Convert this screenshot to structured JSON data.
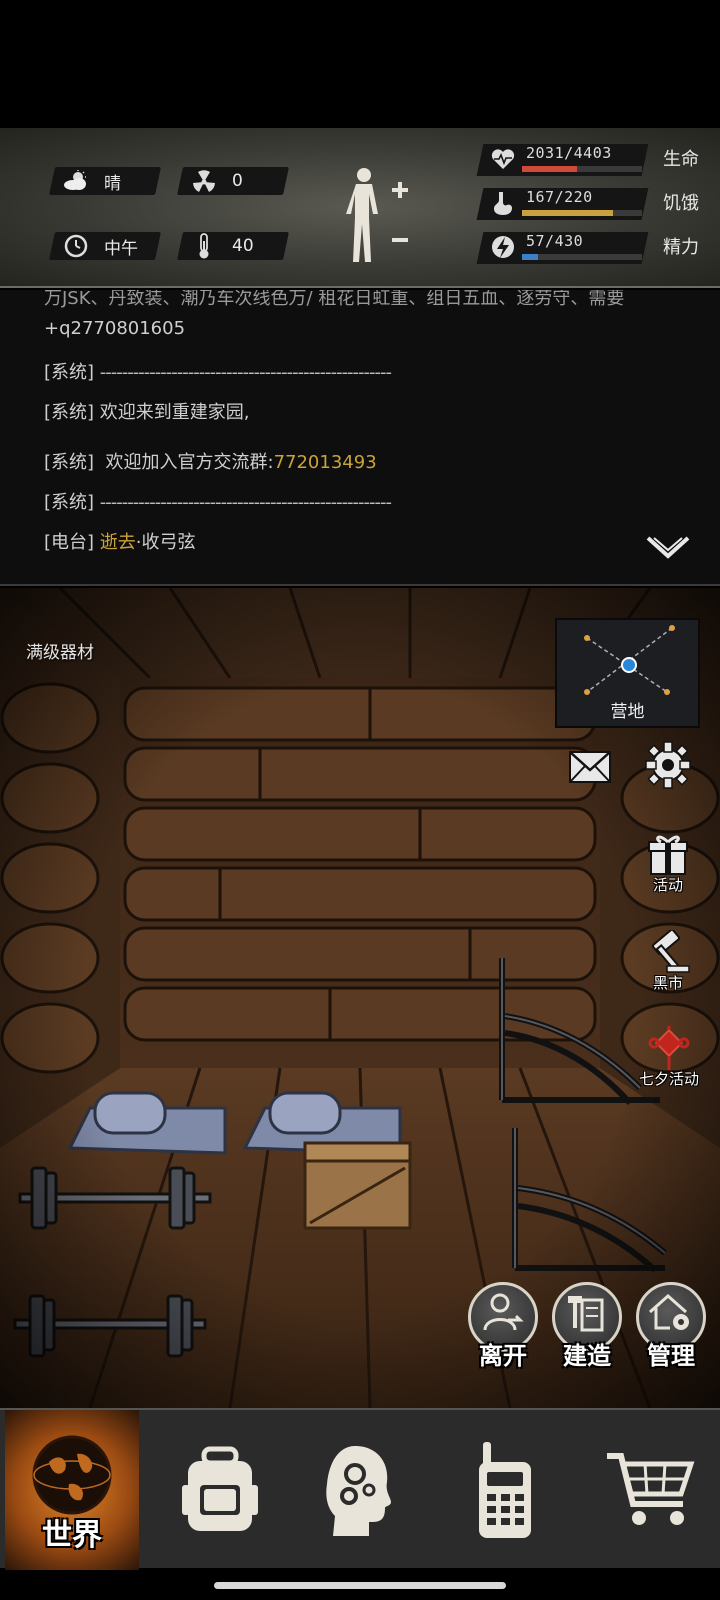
{
  "status": {
    "weather": {
      "icon": "cloud-sun-icon",
      "label": "晴"
    },
    "radiation": {
      "icon": "radiation-icon",
      "value": "0"
    },
    "time": {
      "icon": "clock-icon",
      "label": "中午"
    },
    "temperature": {
      "icon": "thermometer-icon",
      "value": "40"
    },
    "bars": [
      {
        "key": "life",
        "icon": "heart-pulse-icon",
        "value": "2031/4403",
        "label": "生命",
        "fraction": 0.461,
        "color": "#d04a3a"
      },
      {
        "key": "hunger",
        "icon": "stomach-icon",
        "value": "167/220",
        "label": "饥饿",
        "fraction": 0.759,
        "color": "#c9a13e"
      },
      {
        "key": "energy",
        "icon": "lightning-icon",
        "value": "57/430",
        "label": "精力",
        "fraction": 0.133,
        "color": "#3b82c4"
      }
    ]
  },
  "chat": {
    "cut_line": "万JSK、丹致装、潮乃车次线色万/ 租花日虹重、组日五血、逐劳守、需要",
    "qq_line": "+q2770801605",
    "lines": [
      {
        "tag": "[系统]",
        "text": "-----------------------------------------------------"
      },
      {
        "tag": "[系统]",
        "text": "欢迎来到重建家园,"
      },
      {
        "tag": "[系统]",
        "text": "欢迎加入官方交流群:",
        "highlight": "772013493"
      },
      {
        "tag": "[系统]",
        "text": "-----------------------------------------------------"
      },
      {
        "tag": "[电台]",
        "highlight_first": "逝去",
        "text": "·收弓弦"
      }
    ]
  },
  "scene": {
    "label": "满级器材",
    "minimap_label": "营地",
    "side_buttons": [
      {
        "name": "mail-icon",
        "label": ""
      },
      {
        "name": "gear-icon",
        "label": ""
      },
      {
        "name": "gift-icon",
        "label": "活动"
      },
      {
        "name": "gavel-icon",
        "label": "黑市"
      },
      {
        "name": "chinese-knot-icon",
        "label": "七夕活动"
      }
    ],
    "round_buttons": [
      {
        "name": "leave-button",
        "label": "离开"
      },
      {
        "name": "build-button",
        "label": "建造"
      },
      {
        "name": "manage-button",
        "label": "管理"
      }
    ]
  },
  "nav": {
    "world_label": "世界",
    "tabs": [
      "backpack-icon",
      "brain-skills-icon",
      "radio-icon",
      "cart-icon"
    ]
  }
}
